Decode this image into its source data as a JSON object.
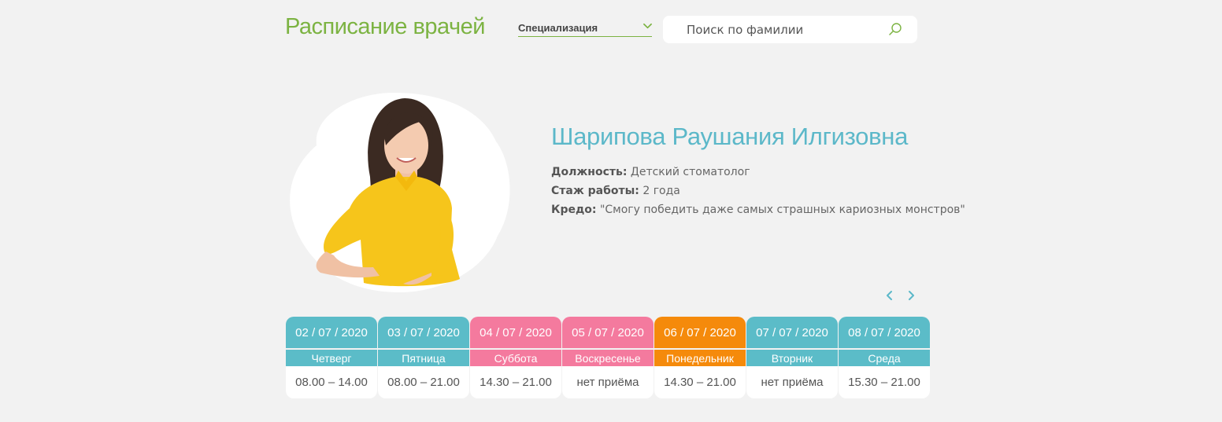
{
  "header": {
    "title": "Расписание врачей",
    "specialization_label": "Специализация",
    "search_placeholder": "Поиск по фамилии"
  },
  "doctor": {
    "name": "Шарипова Раушания Илгизовна",
    "position_label": "Должность:",
    "position": "Детский стоматолог",
    "experience_label": "Стаж работы:",
    "experience": "2 года",
    "credo_label": "Кредо:",
    "credo": "\"Смогу победить даже самых страшных кариозных монстров\""
  },
  "schedule": [
    {
      "date": "02 / 07 / 2020",
      "weekday": "Четверг",
      "hours": "08.00 – 14.00",
      "color": "#5bbcc8"
    },
    {
      "date": "03 / 07 / 2020",
      "weekday": "Пятница",
      "hours": "08.00 – 21.00",
      "color": "#5bbcc8"
    },
    {
      "date": "04 / 07 / 2020",
      "weekday": "Суббота",
      "hours": "14.30 – 21.00",
      "color": "#f47a9e"
    },
    {
      "date": "05 / 07 / 2020",
      "weekday": "Воскресенье",
      "hours": "нет приёма",
      "color": "#f47a9e"
    },
    {
      "date": "06 / 07 / 2020",
      "weekday": "Понедельник",
      "hours": "14.30 – 21.00",
      "color": "#f58a0b"
    },
    {
      "date": "07 / 07 / 2020",
      "weekday": "Вторник",
      "hours": "нет приёма",
      "color": "#5bbcc8"
    },
    {
      "date": "08 / 07 / 2020",
      "weekday": "Среда",
      "hours": "15.30 – 21.00",
      "color": "#5bbcc8"
    }
  ],
  "colors": {
    "accent_green": "#7cb342",
    "accent_teal": "#5cb8c9",
    "weekend_pink": "#f47a9e",
    "today_orange": "#f58a0b"
  },
  "icons": {
    "specialization": "chevron-down-icon",
    "search": "search-icon",
    "prev": "chevron-left-icon",
    "next": "chevron-right-icon"
  }
}
